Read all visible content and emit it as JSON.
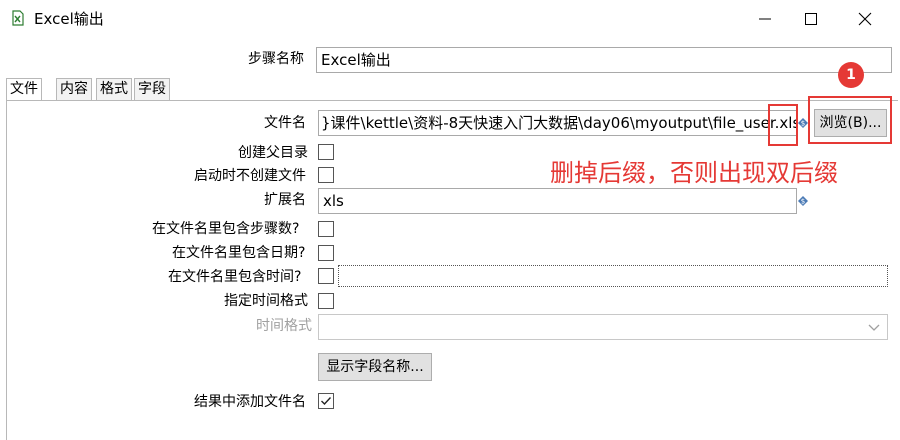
{
  "window": {
    "title": "Excel输出",
    "icon": "excel-output-icon",
    "controls": [
      "minimize-icon",
      "maximize-icon",
      "close-icon"
    ]
  },
  "step_name": {
    "label": "步骤名称",
    "value": "Excel输出"
  },
  "tabs": [
    {
      "label": "文件",
      "active": true
    },
    {
      "label": "内容",
      "active": false
    },
    {
      "label": "格式",
      "active": false
    },
    {
      "label": "字段",
      "active": false
    }
  ],
  "file_tab": {
    "filename": {
      "label": "文件名",
      "value": "}课件\\kettle\\资料-8天快速入门大数据\\day06\\myoutput\\file_user.xls"
    },
    "browse_button": "浏览(B)...",
    "create_parent_dir": {
      "label": "创建父目录",
      "checked": false
    },
    "no_create_on_start": {
      "label": "启动时不创建文件",
      "checked": false
    },
    "extension": {
      "label": "扩展名",
      "value": "xls"
    },
    "include_stepnr": {
      "label": "在文件名里包含步骤数?",
      "checked": false
    },
    "include_date": {
      "label": "在文件名里包含日期?",
      "checked": false
    },
    "include_time": {
      "label": "在文件名里包含时间?",
      "checked": false,
      "value": ""
    },
    "specify_format": {
      "label": "指定时间格式",
      "checked": false
    },
    "date_format": {
      "label": "时间格式",
      "value": "",
      "disabled": true
    },
    "show_fields_button": "显示字段名称...",
    "add_to_result": {
      "label": "结果中添加文件名",
      "checked": true
    }
  },
  "annotation": {
    "badge": "1",
    "note": "删掉后缀，否则出现双后缀",
    "color": "#e53935"
  }
}
